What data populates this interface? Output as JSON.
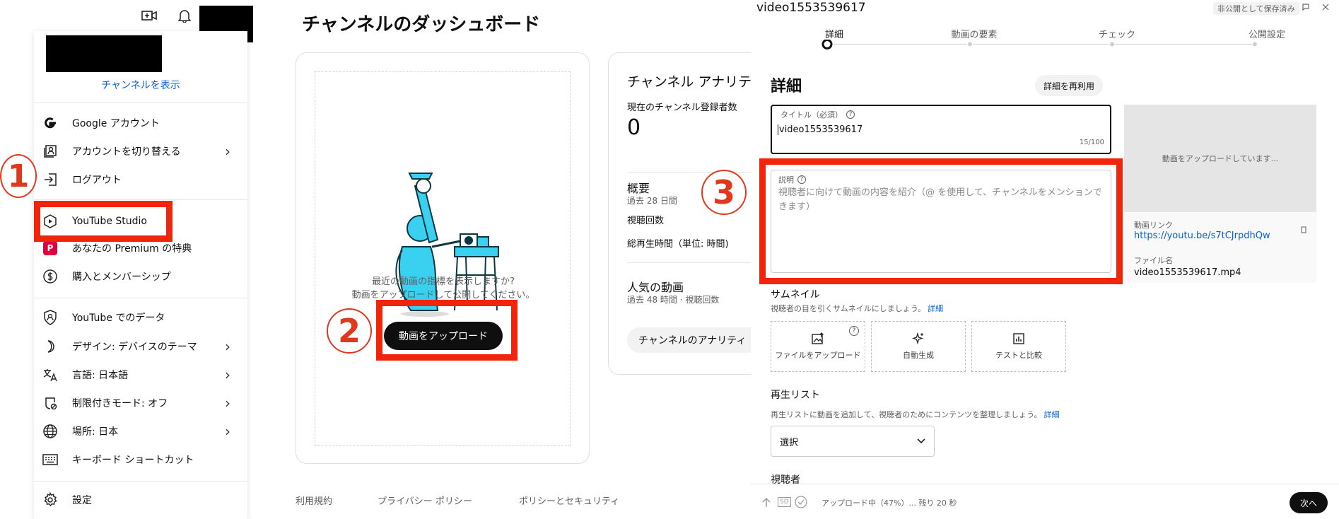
{
  "panel1": {
    "channel_link": "チャンネルを表示",
    "menu_items": [
      {
        "label": "Google アカウント",
        "icon": "google-icon"
      },
      {
        "label": "アカウントを切り替える",
        "icon": "switch-account-icon",
        "chevron": true
      },
      {
        "label": "ログアウト",
        "icon": "logout-icon"
      },
      {
        "label": "YouTube Studio",
        "icon": "youtube-studio-icon"
      },
      {
        "label": "あなたの Premium の特典",
        "icon": "premium-icon",
        "icon_text": "P"
      },
      {
        "label": "購入とメンバーシップ",
        "icon": "dollar-icon"
      },
      {
        "label": "YouTube でのデータ",
        "icon": "shield-user-icon"
      },
      {
        "label": "デザイン: デバイスのテーマ",
        "icon": "moon-icon",
        "chevron": true
      },
      {
        "label": "言語: 日本語",
        "icon": "translate-icon",
        "chevron": true
      },
      {
        "label": "制限付きモード: オフ",
        "icon": "restricted-icon",
        "chevron": true
      },
      {
        "label": "場所: 日本",
        "icon": "globe-icon",
        "chevron": true
      },
      {
        "label": "キーボード ショートカット",
        "icon": "keyboard-icon"
      },
      {
        "label": "設定",
        "icon": "gear-icon"
      }
    ],
    "chevron_glyph": "›",
    "step_number": "1"
  },
  "panel2": {
    "title": "チャンネルのダッシュボード",
    "prompt_line1": "最近の動画の指標を表示しますか?",
    "prompt_line2": "動画をアップロードして公開してください。",
    "upload_button": "動画をアップロード",
    "step_number": "2",
    "analytics": {
      "title": "チャンネル アナリテ",
      "subscribers_label": "現在のチャンネル登録者数",
      "subscribers_value": "0",
      "summary_title": "概要",
      "summary_period": "過去 28 日間",
      "views": "視聴回数",
      "watch_time": "総再生時間（単位: 時間)",
      "popular_title": "人気の動画",
      "popular_period": "過去 48 時間 · 視聴回数",
      "button": "チャンネルのアナリティ"
    },
    "footer": [
      "利用規約",
      "プライバシー ポリシー",
      "ポリシーとセキュリティ"
    ]
  },
  "panel3": {
    "video_title": "video1553539617",
    "saved_badge": "非公開として保存済み",
    "steps": [
      "詳細",
      "動画の要素",
      "チェック",
      "公開設定"
    ],
    "section_title": "詳細",
    "reuse_button": "詳細を再利用",
    "title_field": {
      "label": "タイトル（必須）",
      "value": "video1553539617",
      "counter": "15/100"
    },
    "desc_field": {
      "label": "説明",
      "placeholder": "視聴者に向けて動画の内容を紹介（@ を使用して、チャンネルをメンションできます）"
    },
    "step_number": "3",
    "preview": {
      "uploading": "動画をアップロードしています...",
      "link_label": "動画リンク",
      "link": "https://youtu.be/s7tCJrpdhQw",
      "file_label": "ファイル名",
      "file_name": "video1553539617.mp4"
    },
    "thumbnail": {
      "title": "サムネイル",
      "desc": "視聴者の目を引くサムネイルにしましょう。",
      "more": "詳細",
      "options": [
        "ファイルをアップロード",
        "自動生成",
        "テストと比較"
      ]
    },
    "playlist": {
      "title": "再生リスト",
      "desc": "再生リストに動画を追加して、視聴者のためにコンテンツを整理しましょう。",
      "more": "詳細",
      "select": "選択"
    },
    "audience_title": "視聴者",
    "status": {
      "sd": "SD",
      "text": "アップロード中（47%）... 残り 20 秒",
      "progress_percent": 47
    },
    "next_button": "次へ"
  },
  "colors": {
    "red_box": "#f0250c",
    "circle": "#e0381d",
    "link": "#065fd4",
    "illustration": "#3ad0f0"
  }
}
